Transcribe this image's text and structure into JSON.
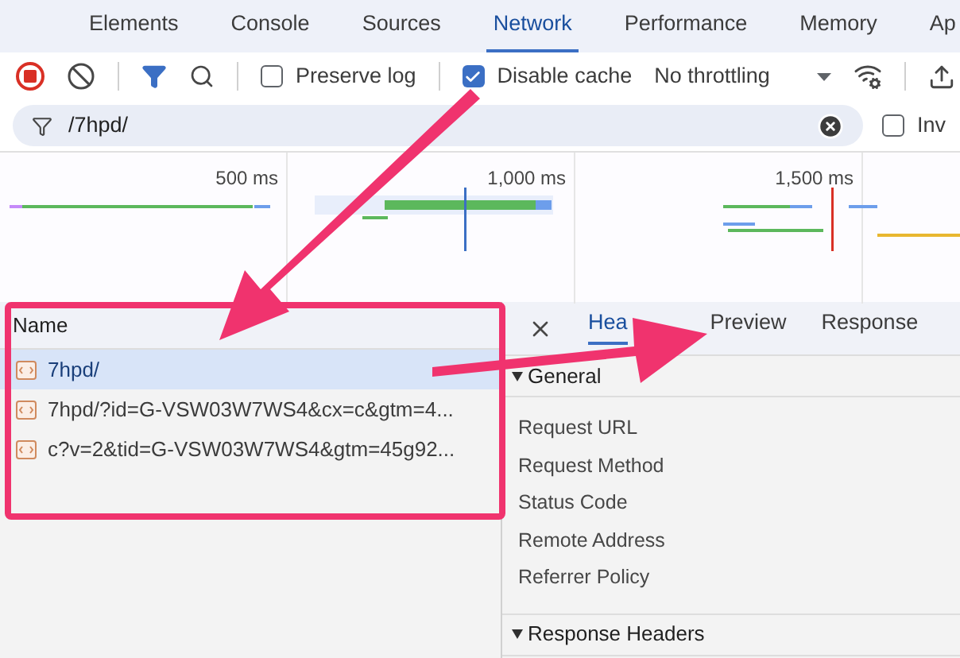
{
  "tabs": [
    {
      "label": "Elements",
      "selected": false
    },
    {
      "label": "Console",
      "selected": false
    },
    {
      "label": "Sources",
      "selected": false
    },
    {
      "label": "Network",
      "selected": true
    },
    {
      "label": "Performance",
      "selected": false
    },
    {
      "label": "Memory",
      "selected": false
    },
    {
      "label": "Ap",
      "selected": false
    }
  ],
  "toolbar": {
    "recording": true,
    "preserve_log": {
      "label": "Preserve log",
      "checked": false
    },
    "disable_cache": {
      "label": "Disable cache",
      "checked": true
    },
    "throttling": "No throttling"
  },
  "filter": {
    "value": "/7hpd/",
    "invert": {
      "label": "Inv",
      "checked": false
    }
  },
  "timeline": {
    "ticks": [
      "500 ms",
      "1,000 ms",
      "1,500 ms"
    ]
  },
  "requests": {
    "column": "Name",
    "rows": [
      {
        "name": "7hpd/",
        "selected": true
      },
      {
        "name": "7hpd/?id=G-VSW03W7WS4&cx=c&gtm=4...",
        "selected": false
      },
      {
        "name": "c?v=2&tid=G-VSW03W7WS4&gtm=45g92...",
        "selected": false
      }
    ]
  },
  "detail_tabs": [
    {
      "label": "Hea",
      "selected": true
    },
    {
      "label": "Preview",
      "selected": false
    },
    {
      "label": "Response",
      "selected": false
    }
  ],
  "sections": [
    {
      "title": "General",
      "expanded": true,
      "rows": [
        "Request URL",
        "Request Method",
        "Status Code",
        "Remote Address",
        "Referrer Policy"
      ]
    },
    {
      "title": "Response Headers",
      "expanded": true
    }
  ]
}
